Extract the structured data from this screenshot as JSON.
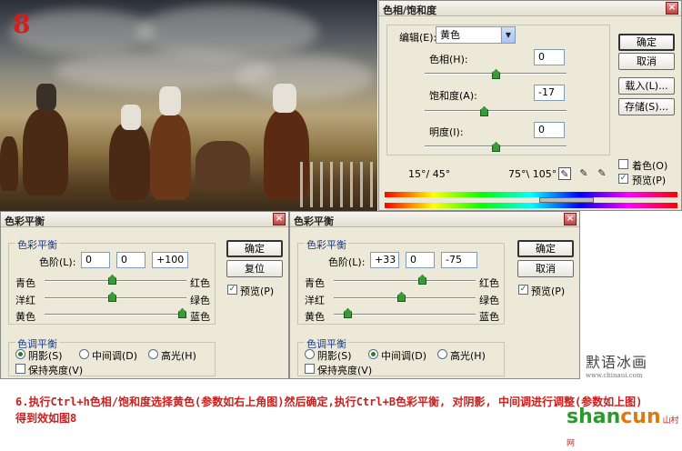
{
  "photo": {
    "step_number": "8"
  },
  "hue_dialog": {
    "title": "色相/饱和度",
    "edit_label": "编辑(E):",
    "edit_value": "黄色",
    "hue_label": "色相(H):",
    "hue_value": "0",
    "saturation_label": "饱和度(A):",
    "saturation_value": "-17",
    "lightness_label": "明度(I):",
    "lightness_value": "0",
    "ok": "确定",
    "cancel": "取消",
    "load": "载入(L)...",
    "save": "存储(S)...",
    "colorize": "着色(O)",
    "preview": "预览(P)",
    "range_left": "15°/ 45°",
    "range_right": "75°\\ 105°",
    "slider_levels": {
      "hue": 0,
      "saturation": -17,
      "lightness": 0
    }
  },
  "balance_left": {
    "title": "色彩平衡",
    "group_balance": "色彩平衡",
    "levels_label": "色阶(L):",
    "levels": [
      "0",
      "0",
      "+100"
    ],
    "row1": [
      "青色",
      "红色"
    ],
    "row2": [
      "洋红",
      "绿色"
    ],
    "row3": [
      "黄色",
      "蓝色"
    ],
    "ok": "确定",
    "reset": "复位",
    "preview": "预览(P)",
    "group_tone": "色调平衡",
    "shadows": "阴影(S)",
    "midtones": "中间调(D)",
    "highlights": "高光(H)",
    "preserve": "保持亮度(V)"
  },
  "balance_right": {
    "title": "色彩平衡",
    "group_balance": "色彩平衡",
    "levels_label": "色阶(L):",
    "levels": [
      "+33",
      "0",
      "-75"
    ],
    "row1": [
      "青色",
      "红色"
    ],
    "row2": [
      "洋红",
      "绿色"
    ],
    "row3": [
      "黄色",
      "蓝色"
    ],
    "ok": "确定",
    "cancel": "取消",
    "preview": "预览(P)",
    "group_tone": "色调平衡",
    "shadows": "阴影(S)",
    "midtones": "中间调(D)",
    "highlights": "高光(H)",
    "preserve": "保持亮度(V)"
  },
  "caption": {
    "line1": "6.执行Ctrl+h色相/饱和度选择黄色(参数如右上角图)然后确定,执行Ctrl+B色彩平衡, 对阴影, 中间调进行调整(参数如上图)",
    "line2": "得到效如图8"
  },
  "logo": {
    "text": "默语冰画",
    "small": "www.chinaui.com"
  },
  "brand": {
    "part1": "shan",
    "part2": "cun",
    "part3": "山村网",
    "green": "#2a9a2a",
    "orange": "#e07a10"
  }
}
